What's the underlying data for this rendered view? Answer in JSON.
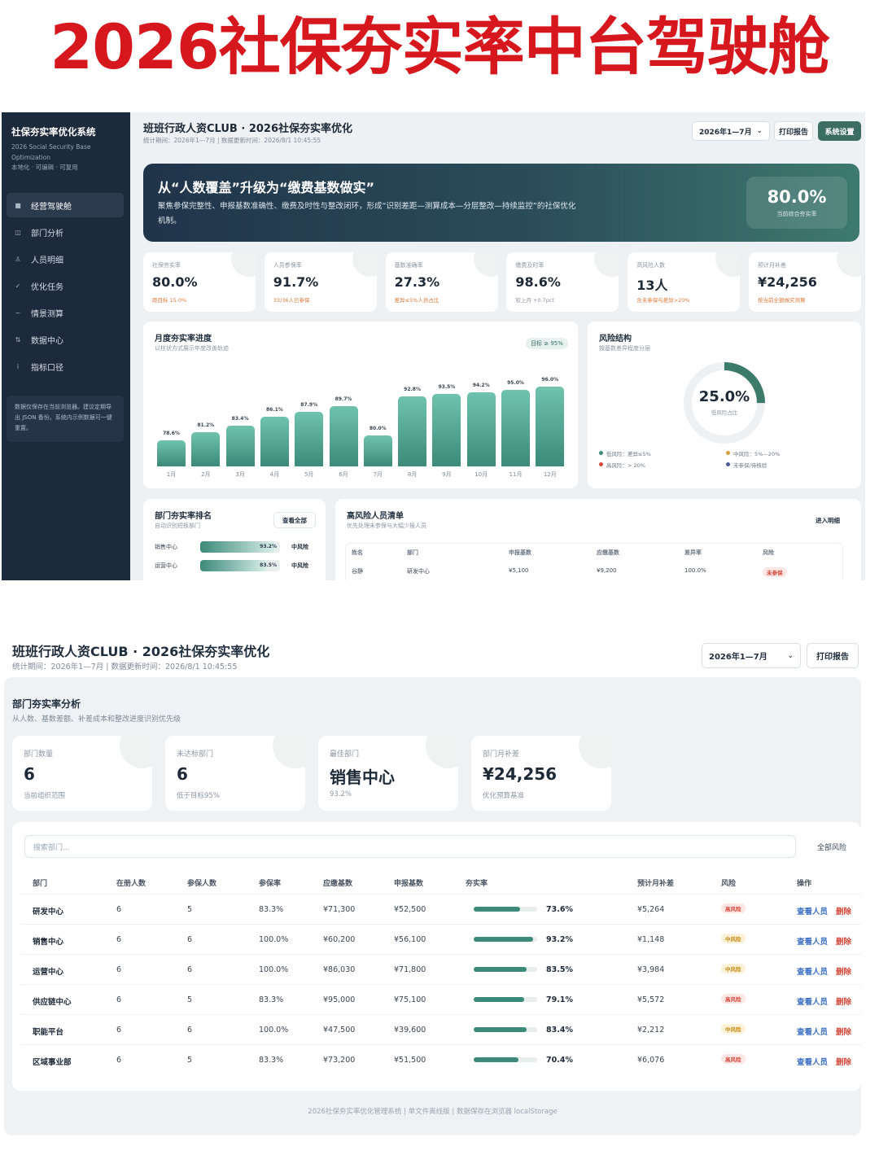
{
  "poster_title": "2026社保夯实率中台驾驶舱",
  "sidebar": {
    "title": "社保夯实率优化系统",
    "subtitle": "2026 Social Security Base Optimization",
    "tagline": "本地化 · 可编辑 · 可复用",
    "items": [
      {
        "icon": "■",
        "label": "经营驾驶舱",
        "active": true
      },
      {
        "icon": "◫",
        "label": "部门分析"
      },
      {
        "icon": "♙",
        "label": "人员明细"
      },
      {
        "icon": "✓",
        "label": "优化任务"
      },
      {
        "icon": "~",
        "label": "情景测算"
      },
      {
        "icon": "⇅",
        "label": "数据中心"
      },
      {
        "icon": "i",
        "label": "指标口径"
      }
    ],
    "note": "数据仅保存在当前浏览器。建议定期导出 JSON 备份。系统内示例数据可一键重置。"
  },
  "header": {
    "title": "班班行政人资CLUB · 2026社保夯实率优化",
    "meta_short": "统计期间：2026年1—7月 | 数据更新时间：2026/8/1 10:45:55",
    "meta_long": "统计期间：2026年1—7月 | 数据更新时间：2026/8/1 10:45:55",
    "period": "2026年1—7月",
    "print_label": "打印报告",
    "settings_label": "系统设置"
  },
  "hero": {
    "heading": "从“人数覆盖”升级为“缴费基数做实”",
    "text": "聚焦参保完整性、申报基数准确性、缴费及时性与整改闭环，形成“识别差距—测算成本—分层整改—持续监控”的社保优化机制。",
    "kpi_value": "80.0%",
    "kpi_label": "当前综合夯实率"
  },
  "kpis": [
    {
      "label": "社保夯实率",
      "value": "80.0%",
      "sub": "距目标 15.0%",
      "accent": true
    },
    {
      "label": "人员参保率",
      "value": "91.7%",
      "sub": "33/36人已参保",
      "accent": true
    },
    {
      "label": "基数准确率",
      "value": "27.3%",
      "sub": "差异≤5%人员占比",
      "accent": true
    },
    {
      "label": "缴费及时率",
      "value": "98.6%",
      "sub": "较上月 +0.7pct",
      "accent": false
    },
    {
      "label": "高风险人数",
      "value": "13人",
      "sub": "含未参保与差异>20%",
      "accent": true
    },
    {
      "label": "预计月补差",
      "value": "¥24,256",
      "sub": "按当前全额做实测算",
      "accent": true
    }
  ],
  "monthly": {
    "title": "月度夯实率进度",
    "subtitle": "以柱状方式展示年度改善轨迹",
    "target": "目标 ≥ 95%"
  },
  "chart_data": {
    "type": "bar",
    "categories": [
      "1月",
      "2月",
      "3月",
      "4月",
      "5月",
      "6月",
      "7月",
      "8月",
      "9月",
      "10月",
      "11月",
      "12月"
    ],
    "values": [
      78.6,
      81.2,
      83.4,
      86.1,
      87.9,
      89.7,
      80.0,
      92.8,
      93.5,
      94.2,
      95.0,
      96.0
    ],
    "labels": [
      "78.6%",
      "81.2%",
      "83.4%",
      "86.1%",
      "87.9%",
      "89.7%",
      "80.0%",
      "92.8%",
      "93.5%",
      "94.2%",
      "95.0%",
      "96.0%"
    ]
  },
  "risk": {
    "title": "风险结构",
    "subtitle": "按基数差异程度分层",
    "value": "25.0%",
    "value_fraction": 0.25,
    "value_label": "低风险占比",
    "legend": [
      {
        "label": "低风险：差异≤5%",
        "color": "#3c8a79"
      },
      {
        "label": "中风险：5%—20%",
        "color": "#d8a13a"
      },
      {
        "label": "高风险：> 20%",
        "color": "#d2483a"
      },
      {
        "label": "未参保/待核验",
        "color": "#4a5a9a"
      }
    ]
  },
  "dept_rank": {
    "title": "部门夯实率排名",
    "subtitle": "自动识别短板部门",
    "view_all": "查看全部",
    "rows": [
      {
        "name": "销售中心",
        "pct": "93.2%",
        "value": 93.2,
        "risk": "中风险"
      },
      {
        "name": "运营中心",
        "pct": "83.5%",
        "value": 83.5,
        "risk": "中风险"
      }
    ]
  },
  "high_risk": {
    "title": "高风险人员清单",
    "subtitle": "优先处理未参保与大幅少报人员",
    "detail_label": "进入明细",
    "headers": [
      "姓名",
      "部门",
      "申报基数",
      "应缴基数",
      "差异率",
      "风险"
    ],
    "rows": [
      {
        "name": "谷静",
        "dept": "研发中心",
        "declared": "¥5,100",
        "due": "¥9,200",
        "diff": "100.0%",
        "risk": "未参保"
      }
    ]
  },
  "dept_analysis": {
    "title": "部门夯实率分析",
    "subtitle": "从人数、基数差额、补差成本和整改进度识别优先级",
    "kpis": [
      {
        "label": "部门数量",
        "value": "6",
        "sub": "当前组织范围"
      },
      {
        "label": "未达标部门",
        "value": "6",
        "sub": "低于目标95%"
      },
      {
        "label": "最佳部门",
        "value": "销售中心",
        "sub": "93.2%"
      },
      {
        "label": "部门月补差",
        "value": "¥24,256",
        "sub": "优化预算基准"
      }
    ],
    "search_placeholder": "搜索部门...",
    "filter": "全部风险",
    "headers": [
      "部门",
      "在册人数",
      "参保人数",
      "参保率",
      "应缴基数",
      "申报基数",
      "夯实率",
      "预计月补差",
      "风险",
      "操作"
    ],
    "rows": [
      {
        "dept": "研发中心",
        "staff": "6",
        "insured": "5",
        "rate": "83.3%",
        "due": "¥71,300",
        "declared": "¥52,500",
        "solid": "73.6%",
        "solid_value": 73.6,
        "gap": "¥5,264",
        "risk": "高风险",
        "level": "high"
      },
      {
        "dept": "销售中心",
        "staff": "6",
        "insured": "6",
        "rate": "100.0%",
        "due": "¥60,200",
        "declared": "¥56,100",
        "solid": "93.2%",
        "solid_value": 93.2,
        "gap": "¥1,148",
        "risk": "中风险",
        "level": "mid"
      },
      {
        "dept": "运营中心",
        "staff": "6",
        "insured": "6",
        "rate": "100.0%",
        "due": "¥86,030",
        "declared": "¥71,800",
        "solid": "83.5%",
        "solid_value": 83.5,
        "gap": "¥3,984",
        "risk": "中风险",
        "level": "mid"
      },
      {
        "dept": "供应链中心",
        "staff": "6",
        "insured": "5",
        "rate": "83.3%",
        "due": "¥95,000",
        "declared": "¥75,100",
        "solid": "79.1%",
        "solid_value": 79.1,
        "gap": "¥5,572",
        "risk": "高风险",
        "level": "high"
      },
      {
        "dept": "职能平台",
        "staff": "6",
        "insured": "6",
        "rate": "100.0%",
        "due": "¥47,500",
        "declared": "¥39,600",
        "solid": "83.4%",
        "solid_value": 83.4,
        "gap": "¥2,212",
        "risk": "中风险",
        "level": "mid"
      },
      {
        "dept": "区域事业部",
        "staff": "6",
        "insured": "5",
        "rate": "83.3%",
        "due": "¥73,200",
        "declared": "¥51,500",
        "solid": "70.4%",
        "solid_value": 70.4,
        "gap": "¥6,076",
        "risk": "高风险",
        "level": "high"
      }
    ],
    "view_label": "查看人员",
    "delete_label": "删除"
  },
  "footer": "2026社保夯实率优化管理系统 | 单文件离线版 | 数据保存在浏览器 localStorage",
  "colors": {
    "brand_red": "#d6181e",
    "sidebar": "#1d2a3c",
    "accent": "#3c6d62",
    "bar": "#4fa892",
    "link": "#3d6fc4",
    "danger": "#d2483a"
  }
}
